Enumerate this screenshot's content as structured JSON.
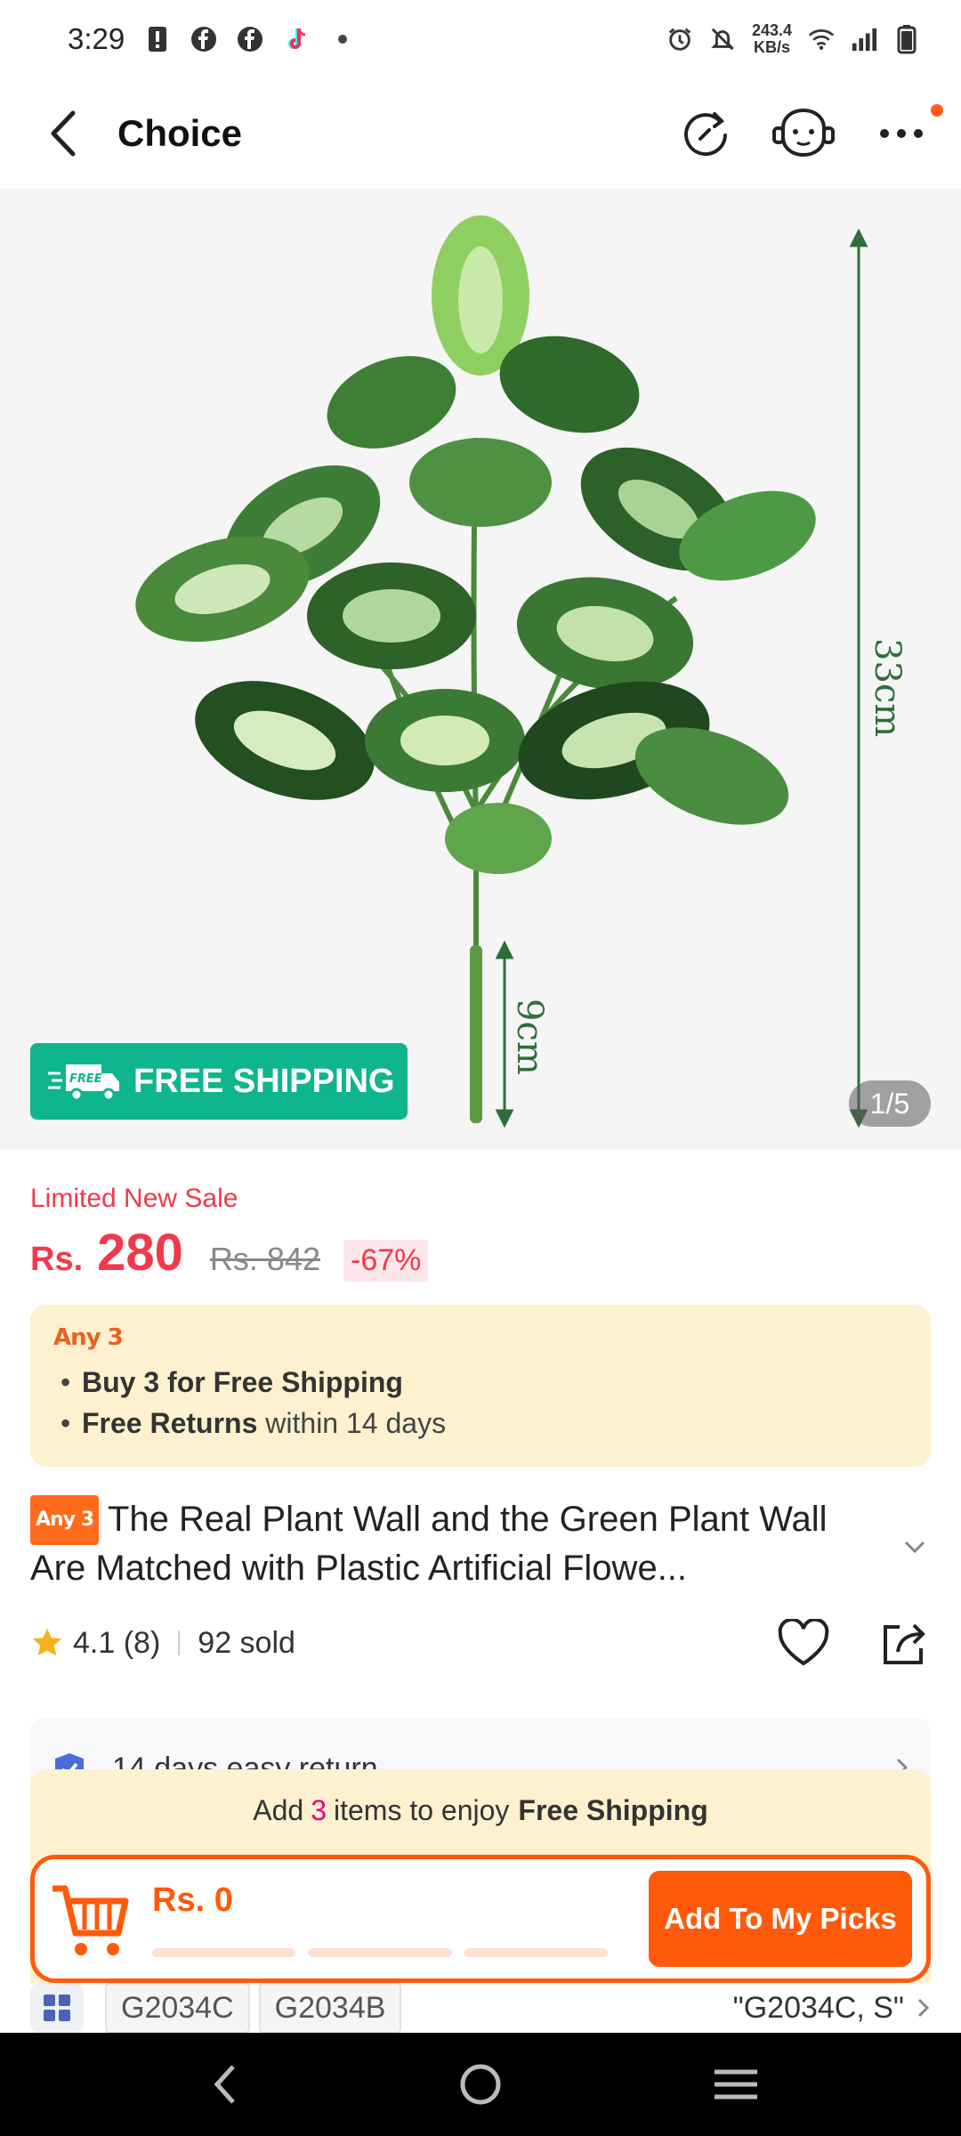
{
  "status_bar": {
    "time": "3:29",
    "net_speed_value": "243.4",
    "net_speed_unit": "KB/s",
    "icons": [
      "alert-icon",
      "facebook-icon",
      "facebook-icon",
      "tiktok-icon",
      "dot-icon",
      "alarm-icon",
      "mute-icon",
      "wifi-icon",
      "signal-icon",
      "battery-icon"
    ]
  },
  "header": {
    "title": "Choice",
    "icons": [
      "back-arrow-icon",
      "refresh-icon",
      "support-bot-icon",
      "more-icon"
    ]
  },
  "gallery": {
    "free_shipping_label": "FREE SHIPPING",
    "truck_label": "FREE",
    "counter": "1/5",
    "dimension_height": "33cm",
    "dimension_stem": "9cm"
  },
  "price": {
    "sale_label": "Limited New Sale",
    "currency": "Rs.",
    "current": "280",
    "original": "Rs. 842",
    "discount": "-67%"
  },
  "promo": {
    "title": "Any 3",
    "line1_bold": "Buy 3 for  Free Shipping",
    "line2_bold": "Free Returns",
    "line2_rest": " within 14 days"
  },
  "product": {
    "tag": "Any 3",
    "title": "The Real Plant Wall and the Green Plant Wall Are Matched with Plastic Artificial Flowe..."
  },
  "rating": {
    "score": "4.1",
    "count": "(8)",
    "sold": "92 sold"
  },
  "service": {
    "label": "14 days easy return"
  },
  "cart": {
    "hint_prefix": "Add",
    "hint_count": "3",
    "hint_middle": "items to enjoy",
    "hint_bold": "Free Shipping",
    "total": "Rs. 0",
    "button_label": "Add To My Picks"
  },
  "variants": {
    "chips": [
      "G2034C",
      "G2034B"
    ],
    "selected": "\"G2034C, S\""
  },
  "colors": {
    "accent": "#ff5a0a",
    "price_red": "#f0394b",
    "free_ship_green": "#0fb58c",
    "promo_bg": "#fdf1cf"
  }
}
